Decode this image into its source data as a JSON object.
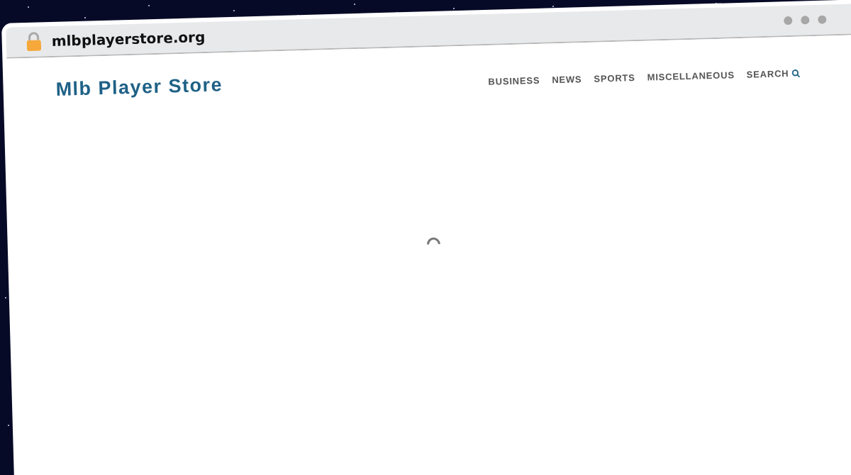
{
  "browser": {
    "url": "mlbplayerstore.org",
    "secure": true
  },
  "site": {
    "title": "Mlb Player Store",
    "nav": [
      {
        "label": "BUSINESS",
        "kind": "link"
      },
      {
        "label": "NEWS",
        "kind": "link"
      },
      {
        "label": "SPORTS",
        "kind": "link"
      },
      {
        "label": "MISCELLANEOUS",
        "kind": "link"
      },
      {
        "label": "SEARCH",
        "kind": "search"
      }
    ]
  },
  "content": {
    "loading": true
  }
}
